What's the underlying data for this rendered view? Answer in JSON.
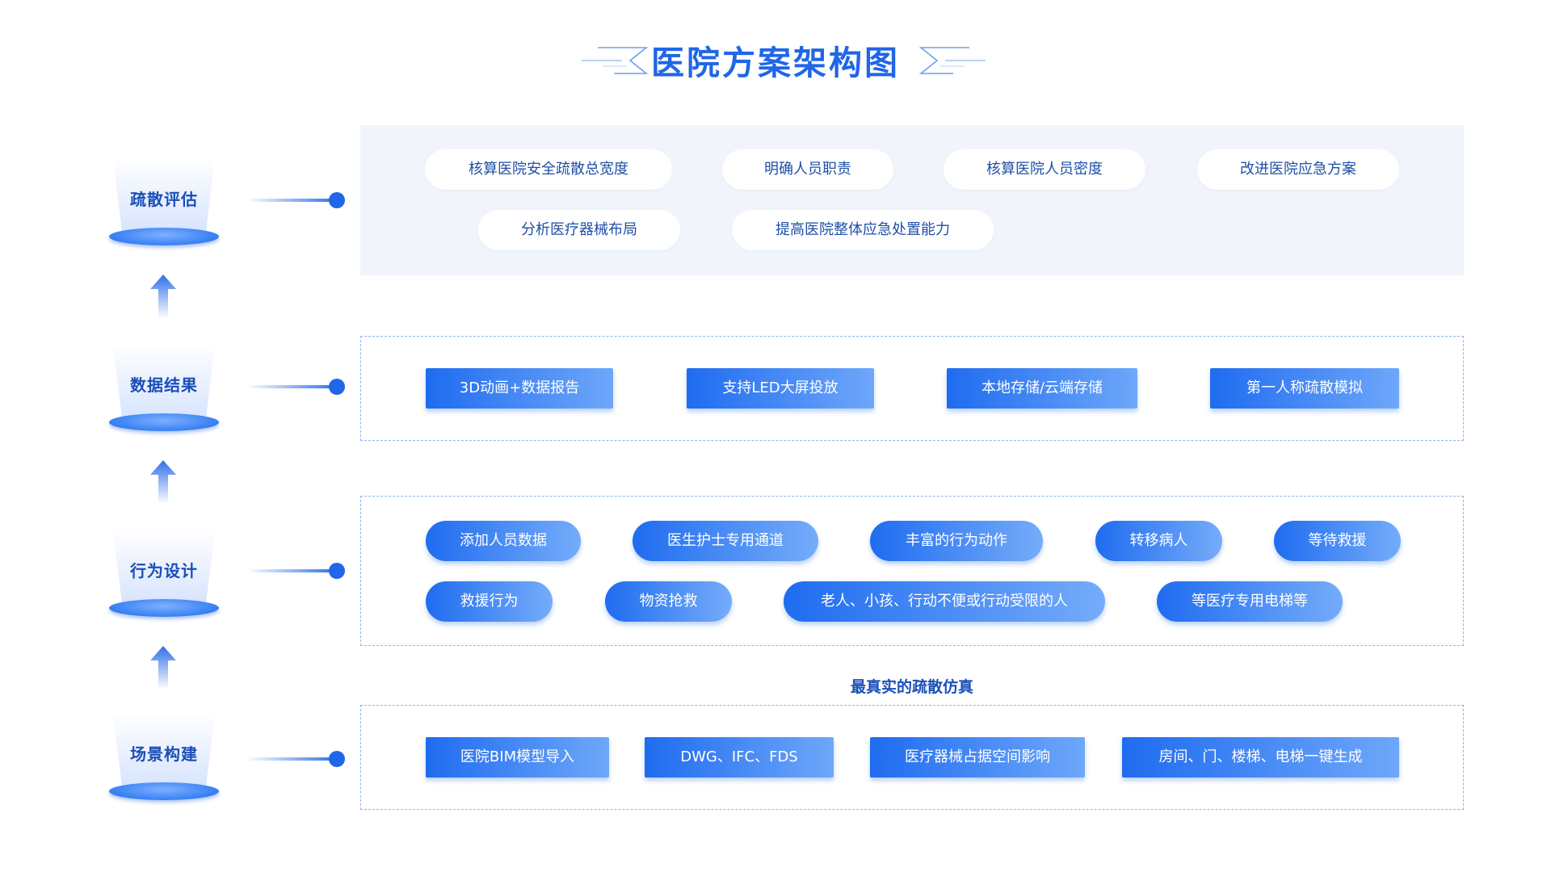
{
  "title": "医院方案架构图",
  "accent_color": "#1f66e8",
  "levels": [
    {
      "label": "疏散评估"
    },
    {
      "label": "数据结果"
    },
    {
      "label": "行为设计"
    },
    {
      "label": "场景构建"
    }
  ],
  "evaluation": {
    "items": [
      "核算医院安全疏散总宽度",
      "明确人员职责",
      "核算医院人员密度",
      "改进医院应急方案",
      "分析医疗器械布局",
      "提高医院整体应急处置能力"
    ]
  },
  "results": {
    "items": [
      "3D动画+数据报告",
      "支持LED大屏投放",
      "本地存储/云端存储",
      "第一人称疏散模拟"
    ]
  },
  "behavior": {
    "items": [
      "添加人员数据",
      "医生护士专用通道",
      "丰富的行为动作",
      "转移病人",
      "等待救援",
      "救援行为",
      "物资抢救",
      "老人、小孩、行动不便或行动受限的人",
      "等医疗专用电梯等"
    ]
  },
  "scene": {
    "subtitle": "最真实的疏散仿真",
    "items": [
      "医院BIM模型导入",
      "DWG、IFC、FDS",
      "医疗器械占据空间影响",
      "房间、门、楼梯、电梯一键生成"
    ]
  }
}
